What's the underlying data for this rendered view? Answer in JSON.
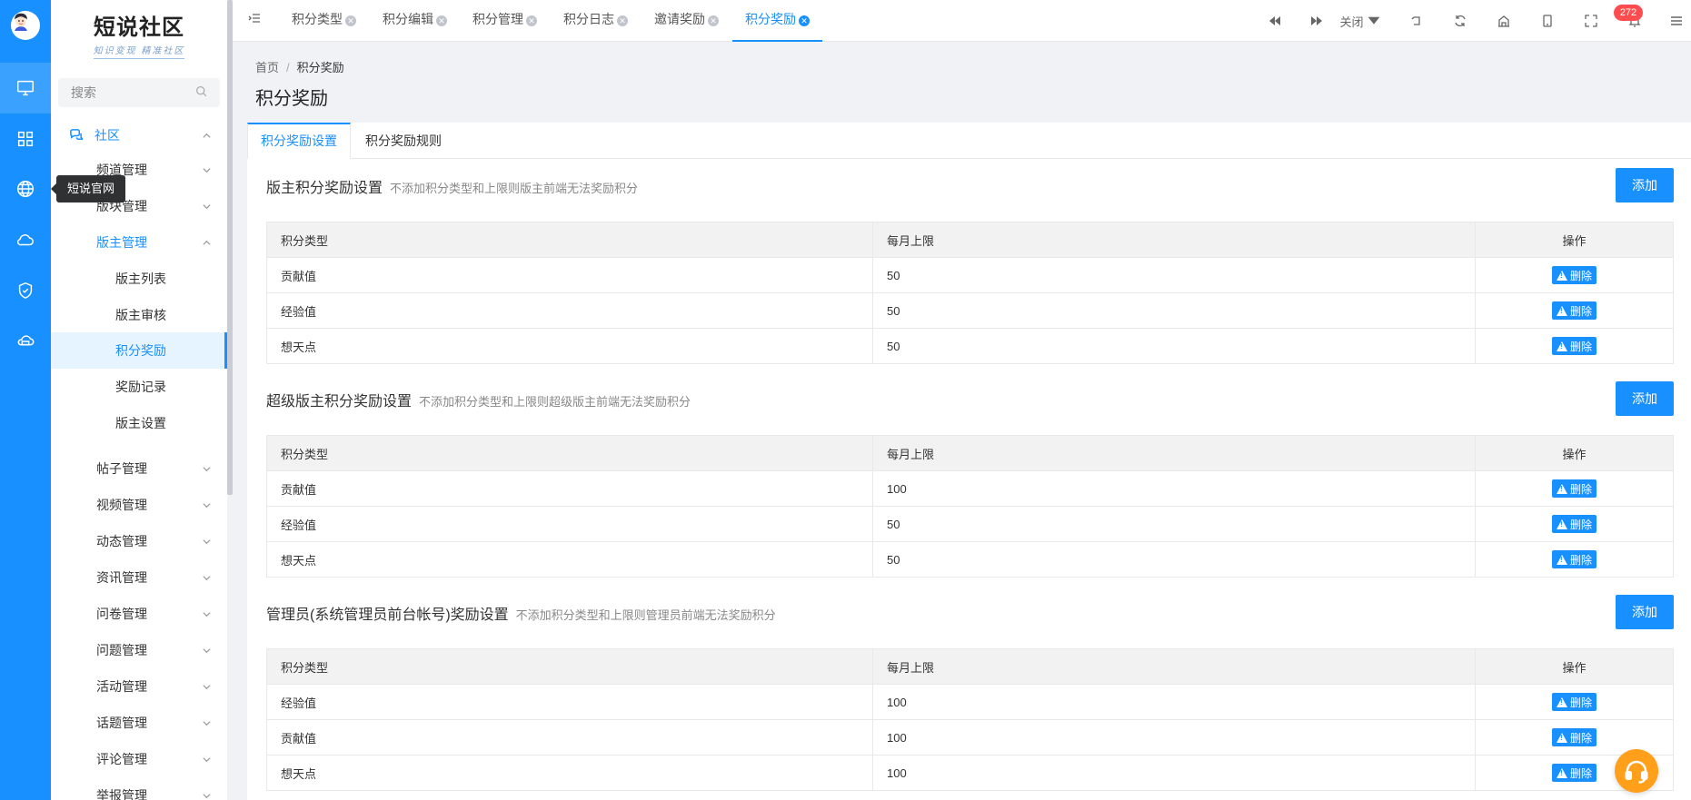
{
  "app": {
    "logo_title": "短说社区",
    "logo_subtitle": "知识变现 精准社区"
  },
  "tooltip": "短说官网",
  "search": {
    "placeholder": "搜索"
  },
  "sidebar": {
    "items": [
      {
        "label": "社区"
      },
      {
        "label": "频道管理"
      },
      {
        "label": "版块管理"
      },
      {
        "label": "版主管理"
      },
      {
        "label": "版主列表"
      },
      {
        "label": "版主审核"
      },
      {
        "label": "积分奖励"
      },
      {
        "label": "奖励记录"
      },
      {
        "label": "版主设置"
      },
      {
        "label": "帖子管理"
      },
      {
        "label": "视频管理"
      },
      {
        "label": "动态管理"
      },
      {
        "label": "资讯管理"
      },
      {
        "label": "问卷管理"
      },
      {
        "label": "问题管理"
      },
      {
        "label": "活动管理"
      },
      {
        "label": "话题管理"
      },
      {
        "label": "评论管理"
      },
      {
        "label": "举报管理"
      }
    ]
  },
  "top_tabs": [
    {
      "label": "积分类型"
    },
    {
      "label": "积分编辑"
    },
    {
      "label": "积分管理"
    },
    {
      "label": "积分日志"
    },
    {
      "label": "邀请奖励"
    },
    {
      "label": "积分奖励"
    }
  ],
  "toolbar": {
    "close_label": "关闭",
    "notification_count": "272"
  },
  "breadcrumb": {
    "home": "首页",
    "current": "积分奖励"
  },
  "page_title": "积分奖励",
  "content_tabs": [
    {
      "label": "积分奖励设置"
    },
    {
      "label": "积分奖励规则"
    }
  ],
  "table_headers": {
    "type": "积分类型",
    "limit": "每月上限",
    "op": "操作"
  },
  "add_label": "添加",
  "delete_label": "删除",
  "sections": [
    {
      "title": "版主积分奖励设置",
      "hint": "不添加积分类型和上限则版主前端无法奖励积分",
      "rows": [
        {
          "type": "贡献值",
          "limit": "50"
        },
        {
          "type": "经验值",
          "limit": "50"
        },
        {
          "type": "想天点",
          "limit": "50"
        }
      ]
    },
    {
      "title": "超级版主积分奖励设置",
      "hint": "不添加积分类型和上限则超级版主前端无法奖励积分",
      "rows": [
        {
          "type": "贡献值",
          "limit": "100"
        },
        {
          "type": "经验值",
          "limit": "50"
        },
        {
          "type": "想天点",
          "limit": "50"
        }
      ]
    },
    {
      "title": "管理员(系统管理员前台帐号)奖励设置",
      "hint": "不添加积分类型和上限则管理员前端无法奖励积分",
      "rows": [
        {
          "type": "经验值",
          "limit": "100"
        },
        {
          "type": "贡献值",
          "limit": "100"
        },
        {
          "type": "想天点",
          "limit": "100"
        }
      ]
    }
  ],
  "colors": {
    "primary": "#1890ff",
    "badge": "#ff4d4f",
    "support": "#ff9f1a"
  }
}
